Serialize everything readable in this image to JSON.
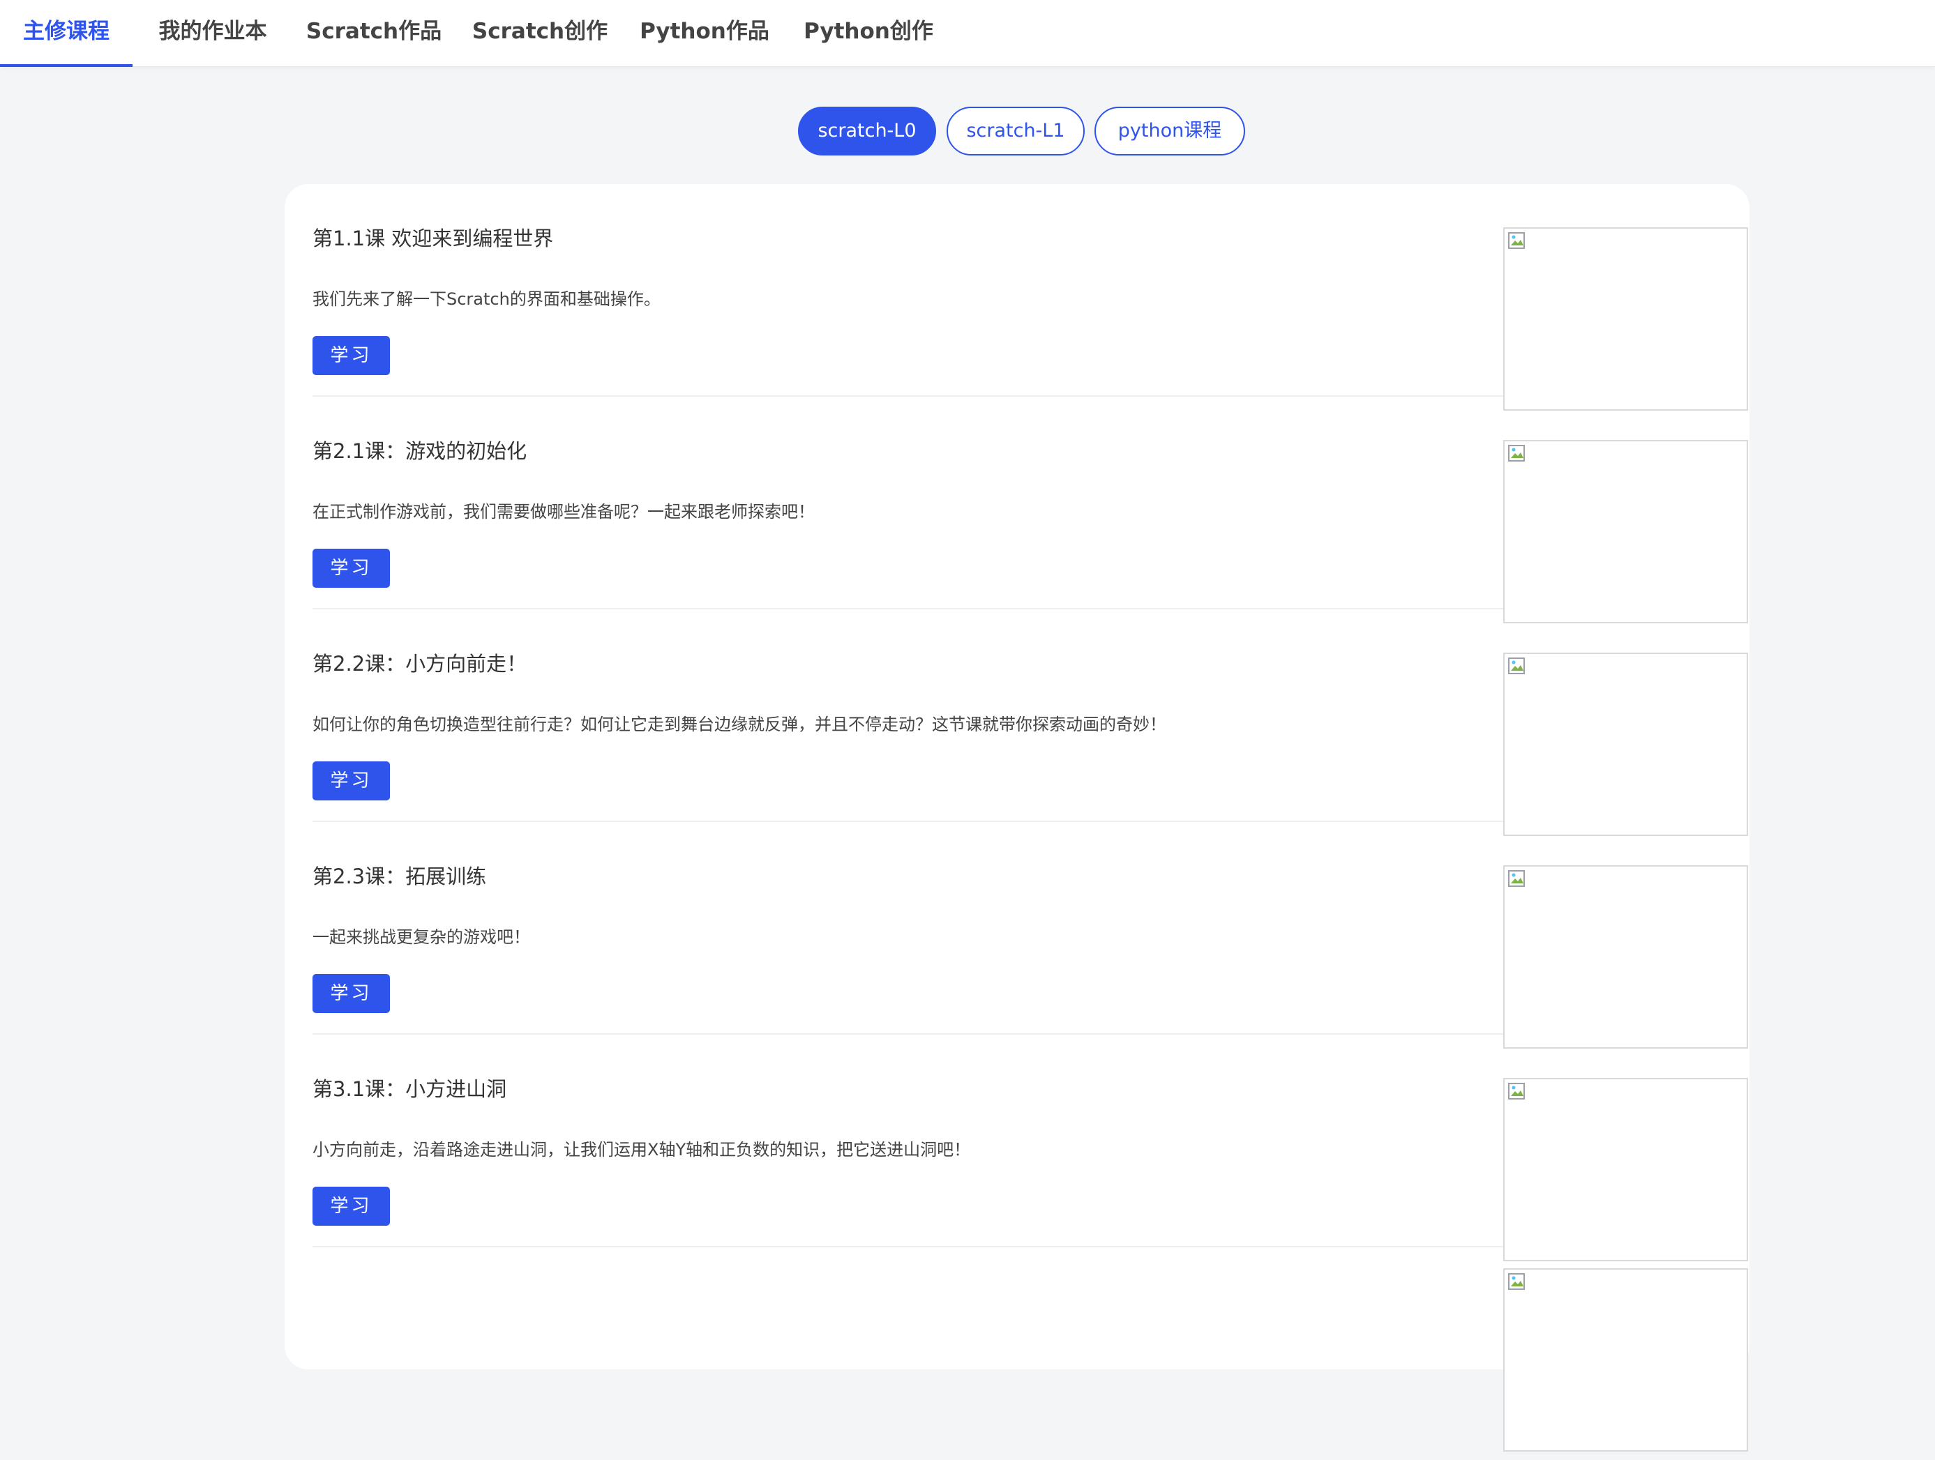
{
  "nav": {
    "tabs": [
      {
        "label": "主修课程",
        "active": true
      },
      {
        "label": "我的作业本",
        "active": false
      },
      {
        "label": "Scratch作品",
        "active": false
      },
      {
        "label": "Scratch创作",
        "active": false
      },
      {
        "label": "Python作品",
        "active": false
      },
      {
        "label": "Python创作",
        "active": false
      }
    ]
  },
  "course_filters": [
    {
      "label": "scratch-L0",
      "active": true
    },
    {
      "label": "scratch-L1",
      "active": false
    },
    {
      "label": "python课程",
      "active": false
    }
  ],
  "study_label": "学习",
  "courses": [
    {
      "title": "第1.1课 欢迎来到编程世界",
      "desc": "我们先来了解一下Scratch的界面和基础操作。"
    },
    {
      "title": "第2.1课：游戏的初始化",
      "desc": "在正式制作游戏前，我们需要做哪些准备呢？一起来跟老师探索吧！"
    },
    {
      "title": "第2.2课：小方向前走！",
      "desc": "如何让你的角色切换造型往前行走？如何让它走到舞台边缘就反弹，并且不停走动？这节课就带你探索动画的奇妙！"
    },
    {
      "title": "第2.3课：拓展训练",
      "desc": "一起来挑战更复杂的游戏吧！"
    },
    {
      "title": "第3.1课：小方进山洞",
      "desc": "小方向前走，沿着路途走进山洞，让我们运用X轴Y轴和正负数的知识，把它送进山洞吧！"
    }
  ],
  "colors": {
    "accent": "#2f54eb",
    "page_bg": "#f4f5f7",
    "card_bg": "#ffffff"
  },
  "icons": {
    "thumbnail": "broken-image-icon"
  }
}
